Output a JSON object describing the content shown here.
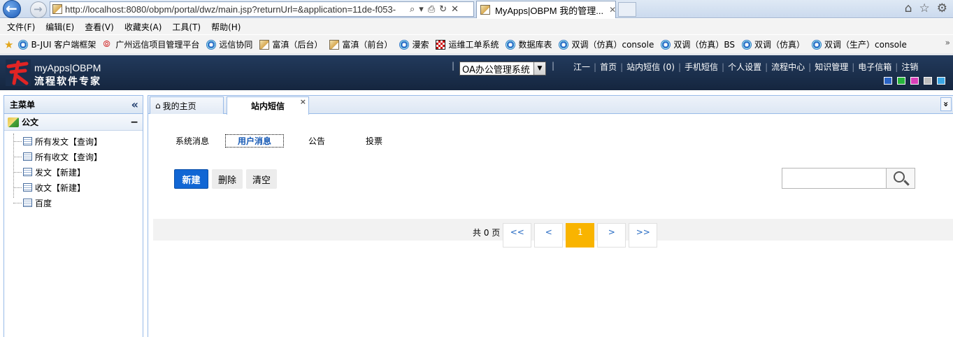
{
  "browser": {
    "url": "http://localhost:8080/obpm/portal/dwz/main.jsp?returnUrl=&application=11de-f053-",
    "address_tools": [
      "⌕",
      "▾",
      "⎙",
      "↻",
      "✕"
    ],
    "tab_title": "MyApps|OBPM 我的管理...",
    "tab_close": "✕",
    "right_icons": [
      "⌂",
      "☆",
      "⚙"
    ]
  },
  "menubar": [
    "文件(F)",
    "编辑(E)",
    "查看(V)",
    "收藏夹(A)",
    "工具(T)",
    "帮助(H)"
  ],
  "favorites": [
    {
      "label": "B-JUI 客户端框架",
      "icon": "ie"
    },
    {
      "label": "广州远信项目管理平台",
      "icon": "arc"
    },
    {
      "label": "远信协同",
      "icon": "ie"
    },
    {
      "label": "富滇（后台）",
      "icon": "img"
    },
    {
      "label": "富滇（前台）",
      "icon": "img"
    },
    {
      "label": "漫索",
      "icon": "ie"
    },
    {
      "label": "运维工单系统",
      "icon": "chk"
    },
    {
      "label": "数据库表",
      "icon": "ie"
    },
    {
      "label": "双调（仿真）console",
      "icon": "ie"
    },
    {
      "label": "双调（仿真）BS",
      "icon": "ie"
    },
    {
      "label": "双调（仿真）",
      "icon": "ie"
    },
    {
      "label": "双调（生产）console",
      "icon": "ie"
    }
  ],
  "favorites_more": "»",
  "header": {
    "logo_main": "myApps|OBPM",
    "logo_sub": "流程软件专家",
    "system_select": "OA办公管理系统",
    "nav": [
      "江一",
      "首页",
      "站内短信 (0)",
      "手机短信",
      "个人设置",
      "流程中心",
      "知识管理",
      "电子信箱",
      "注销"
    ],
    "skins": [
      "#2a64c5",
      "#27b43b",
      "#d83fb8",
      "#bdbdbd",
      "#3ba6e3"
    ]
  },
  "sidebar": {
    "title": "主菜单",
    "collapse": "«",
    "group": "公文",
    "group_toggle": "−",
    "items": [
      "所有发文【查询】",
      "所有收文【查询】",
      "发文【新建】",
      "收文【新建】",
      "百度"
    ]
  },
  "tabs": {
    "home": "我的主页",
    "home_icon": "⌂",
    "active": "站内短信",
    "close": "×",
    "menu": "»"
  },
  "message_tabs": [
    "系统消息",
    "用户消息",
    "公告",
    "投票"
  ],
  "actions": {
    "new": "新建",
    "delete": "删除",
    "clear": "清空"
  },
  "search": {
    "placeholder": ""
  },
  "pager": {
    "total": "共 0 页",
    "first": "<<",
    "prev": "<",
    "current": "1",
    "next": ">",
    "last": ">>"
  }
}
